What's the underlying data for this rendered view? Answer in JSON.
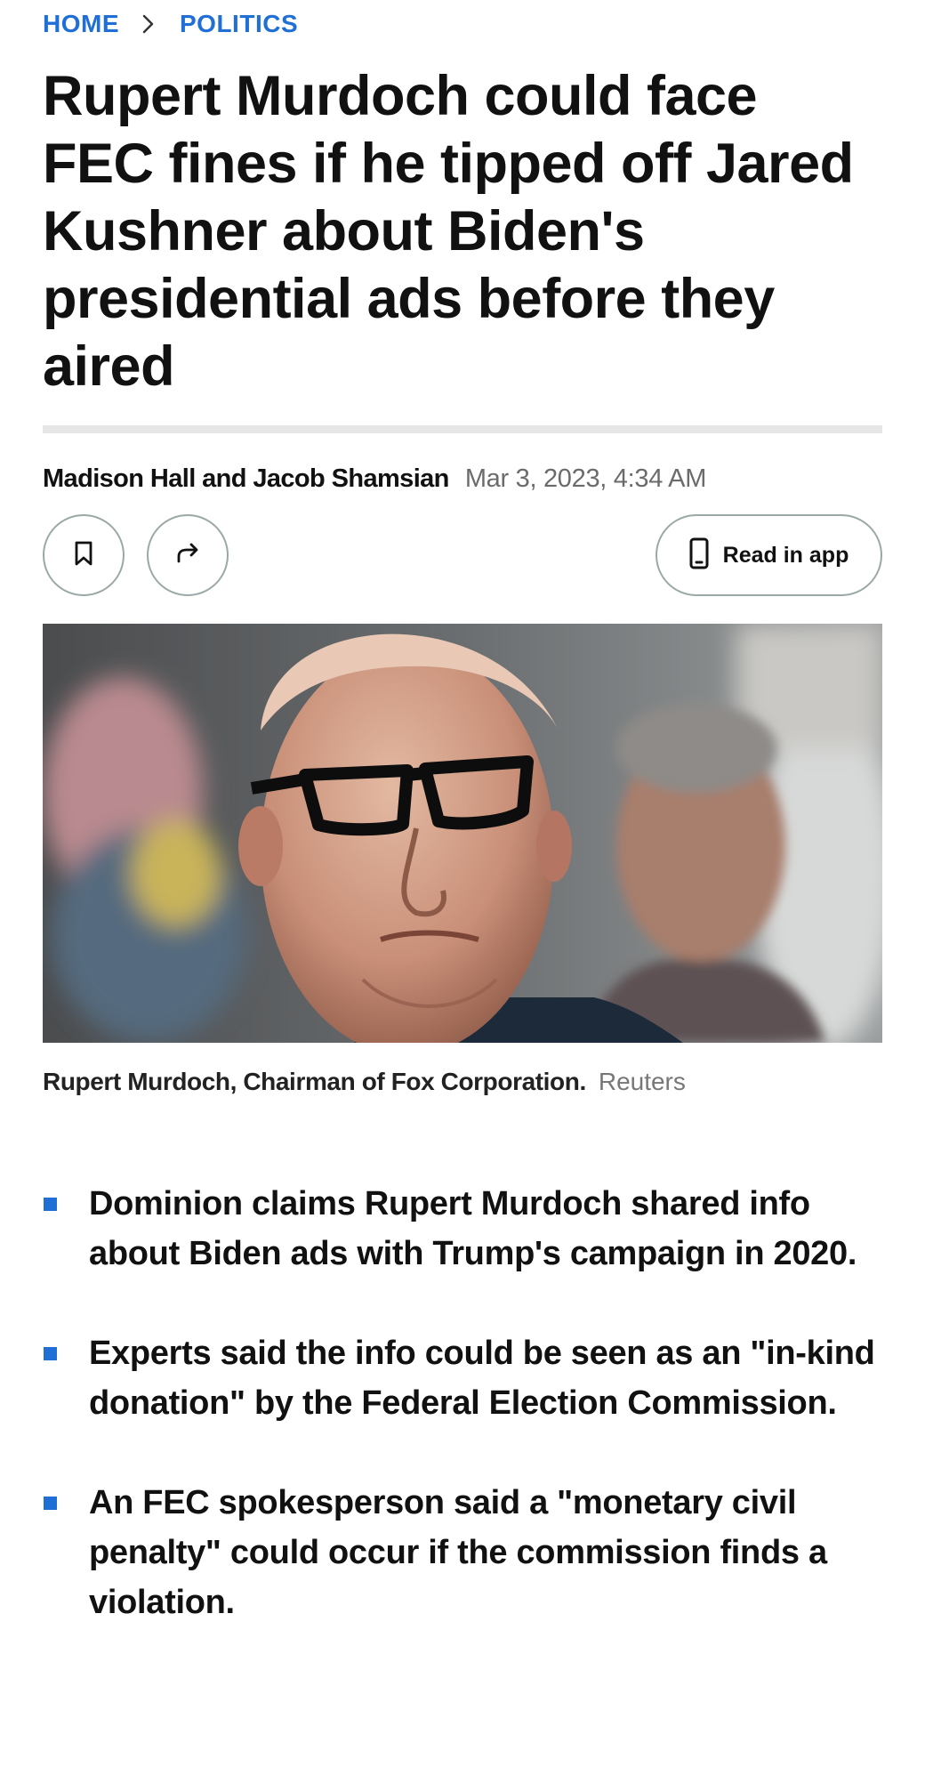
{
  "breadcrumb": {
    "home": "HOME",
    "section": "POLITICS"
  },
  "article": {
    "headline": "Rupert Murdoch could face FEC fines if he tipped off Jared Kushner about Biden's presidential ads before they aired",
    "authors": "Madison Hall and Jacob Shamsian",
    "date": "Mar 3, 2023, 4:34 AM"
  },
  "actions": {
    "save_icon": "bookmark-icon",
    "share_icon": "share-arrow-icon",
    "read_in_app_icon": "phone-icon",
    "read_in_app_label": "Read in app"
  },
  "image": {
    "caption": "Rupert Murdoch, Chairman of Fox Corporation.",
    "credit": "Reuters"
  },
  "key_points": [
    "Dominion claims Rupert Murdoch shared info about Biden ads with Trump's campaign in 2020.",
    "Experts said the info could be seen as an \"in-kind donation\" by the Federal Election Commission.",
    "An FEC spokesperson said a \"monetary civil penalty\" could occur if the commission finds a violation."
  ],
  "colors": {
    "accent": "#1f6fd6",
    "text": "#111111",
    "muted": "#6b6b6b",
    "rule": "#e6e6e6"
  }
}
